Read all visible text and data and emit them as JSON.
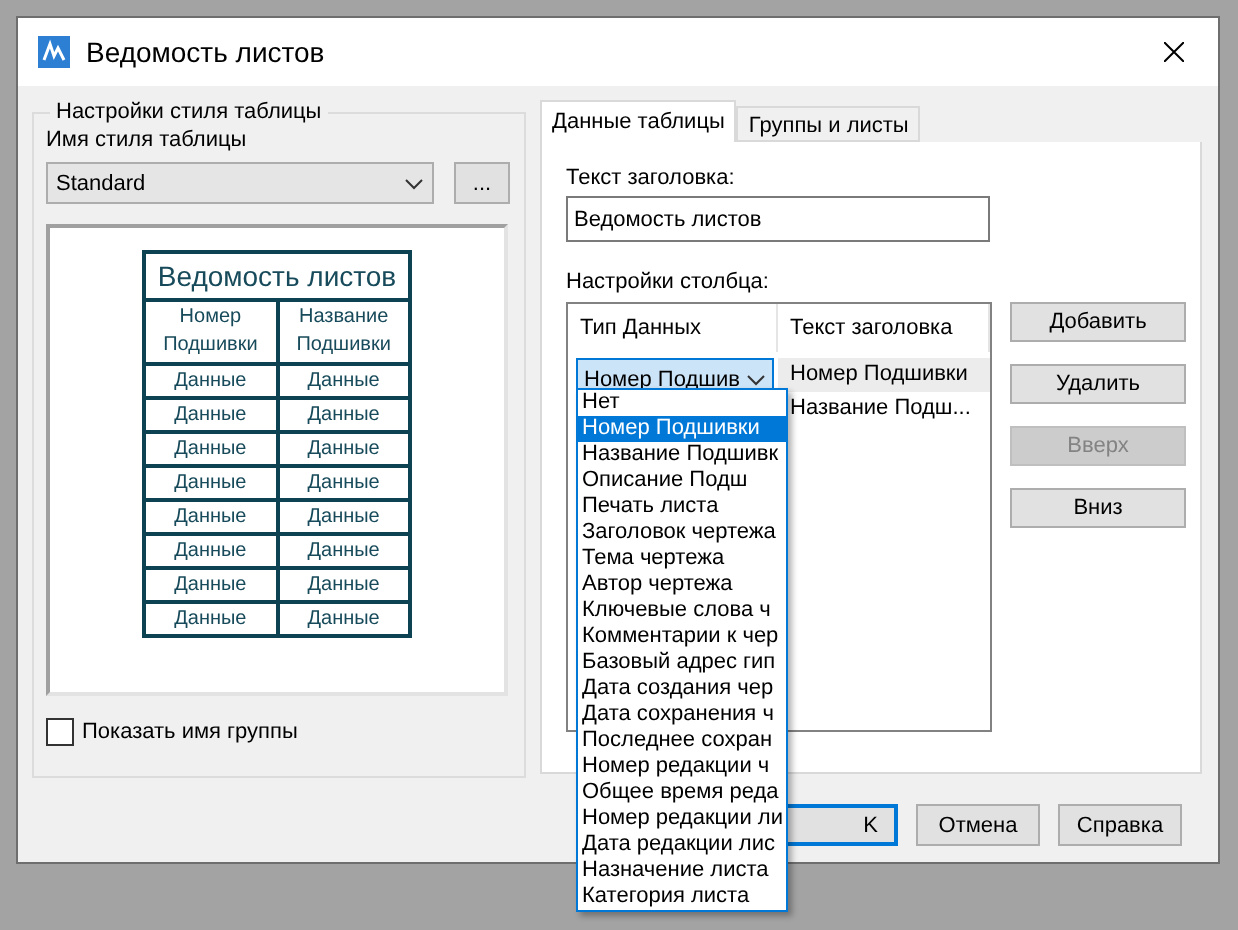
{
  "window": {
    "title": "Ведомость листов"
  },
  "style_group": {
    "legend": "Настройки стиля таблицы",
    "style_label": "Имя стиля таблицы",
    "style_value": "Standard",
    "browse_button": "...",
    "preview": {
      "title": "Ведомость листов",
      "columns": [
        "Номер Подшивки",
        "Название Подшивки"
      ],
      "rows": [
        [
          "Данные",
          "Данные"
        ],
        [
          "Данные",
          "Данные"
        ],
        [
          "Данные",
          "Данные"
        ],
        [
          "Данные",
          "Данные"
        ],
        [
          "Данные",
          "Данные"
        ],
        [
          "Данные",
          "Данные"
        ],
        [
          "Данные",
          "Данные"
        ],
        [
          "Данные",
          "Данные"
        ]
      ]
    },
    "show_group": {
      "label": "Показать имя группы",
      "checked": false
    }
  },
  "tabs": [
    {
      "label": "Данные таблицы",
      "selected": true
    },
    {
      "label": "Группы и листы",
      "selected": false
    }
  ],
  "header_label": "Текст заголовка:",
  "header_value": "Ведомость листов",
  "columns_label": "Настройки столбца:",
  "grid": {
    "columns": [
      "Тип Данных",
      "Текст заголовка"
    ],
    "combo_value": "Номер Подшив",
    "headers": [
      {
        "text": "Номер Подшивки",
        "selected": true
      },
      {
        "text": "Название Подш...",
        "selected": false
      }
    ]
  },
  "side_buttons": [
    {
      "label": "Добавить",
      "disabled": false
    },
    {
      "label": "Удалить",
      "disabled": false
    },
    {
      "label": "Вверх",
      "disabled": true
    },
    {
      "label": "Вниз",
      "disabled": false
    }
  ],
  "dropdown": [
    {
      "text": "Нет",
      "selected": false
    },
    {
      "text": "Номер Подшивки",
      "selected": true
    },
    {
      "text": "Название Подшивк",
      "selected": false
    },
    {
      "text": "Описание Подш",
      "selected": false
    },
    {
      "text": "Печать листа",
      "selected": false
    },
    {
      "text": "Заголовок чертежа",
      "selected": false
    },
    {
      "text": "Тема чертежа",
      "selected": false
    },
    {
      "text": "Автор чертежа",
      "selected": false
    },
    {
      "text": "Ключевые слова ч",
      "selected": false
    },
    {
      "text": "Комментарии к чер",
      "selected": false
    },
    {
      "text": "Базовый адрес гип",
      "selected": false
    },
    {
      "text": "Дата создания чер",
      "selected": false
    },
    {
      "text": "Дата сохранения ч",
      "selected": false
    },
    {
      "text": "Последнее сохран",
      "selected": false
    },
    {
      "text": "Номер редакции ч",
      "selected": false
    },
    {
      "text": "Общее время реда",
      "selected": false
    },
    {
      "text": "Номер редакции ли",
      "selected": false
    },
    {
      "text": "Дата редакции лис",
      "selected": false
    },
    {
      "text": "Назначение листа",
      "selected": false
    },
    {
      "text": "Категория листа",
      "selected": false
    }
  ],
  "footer_buttons": [
    {
      "label": "K",
      "kind": "default"
    },
    {
      "label": "Отмена",
      "kind": "normal"
    },
    {
      "label": "Справка",
      "kind": "normal"
    }
  ]
}
